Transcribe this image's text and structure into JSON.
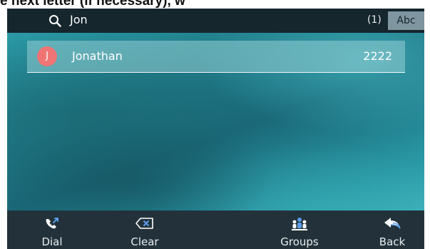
{
  "caption": "e next letter (if necessary), w",
  "search": {
    "query": "Jon",
    "result_count": "(1)",
    "input_mode": "Abc"
  },
  "contacts": [
    {
      "initial": "J",
      "name": "Jonathan",
      "number": "2222",
      "avatar_color": "#ef7474"
    }
  ],
  "softkeys": [
    {
      "label": "Dial",
      "icon": "phone-dial-icon"
    },
    {
      "label": "Clear",
      "icon": "backspace-icon"
    },
    {
      "label": "Groups",
      "icon": "groups-icon"
    },
    {
      "label": "Back",
      "icon": "back-arrow-icon"
    }
  ],
  "colors": {
    "topbar": "#15262d",
    "softkey_bar": "#23323a",
    "icon_blue": "#5a9de8",
    "avatar": "#ef7474"
  }
}
